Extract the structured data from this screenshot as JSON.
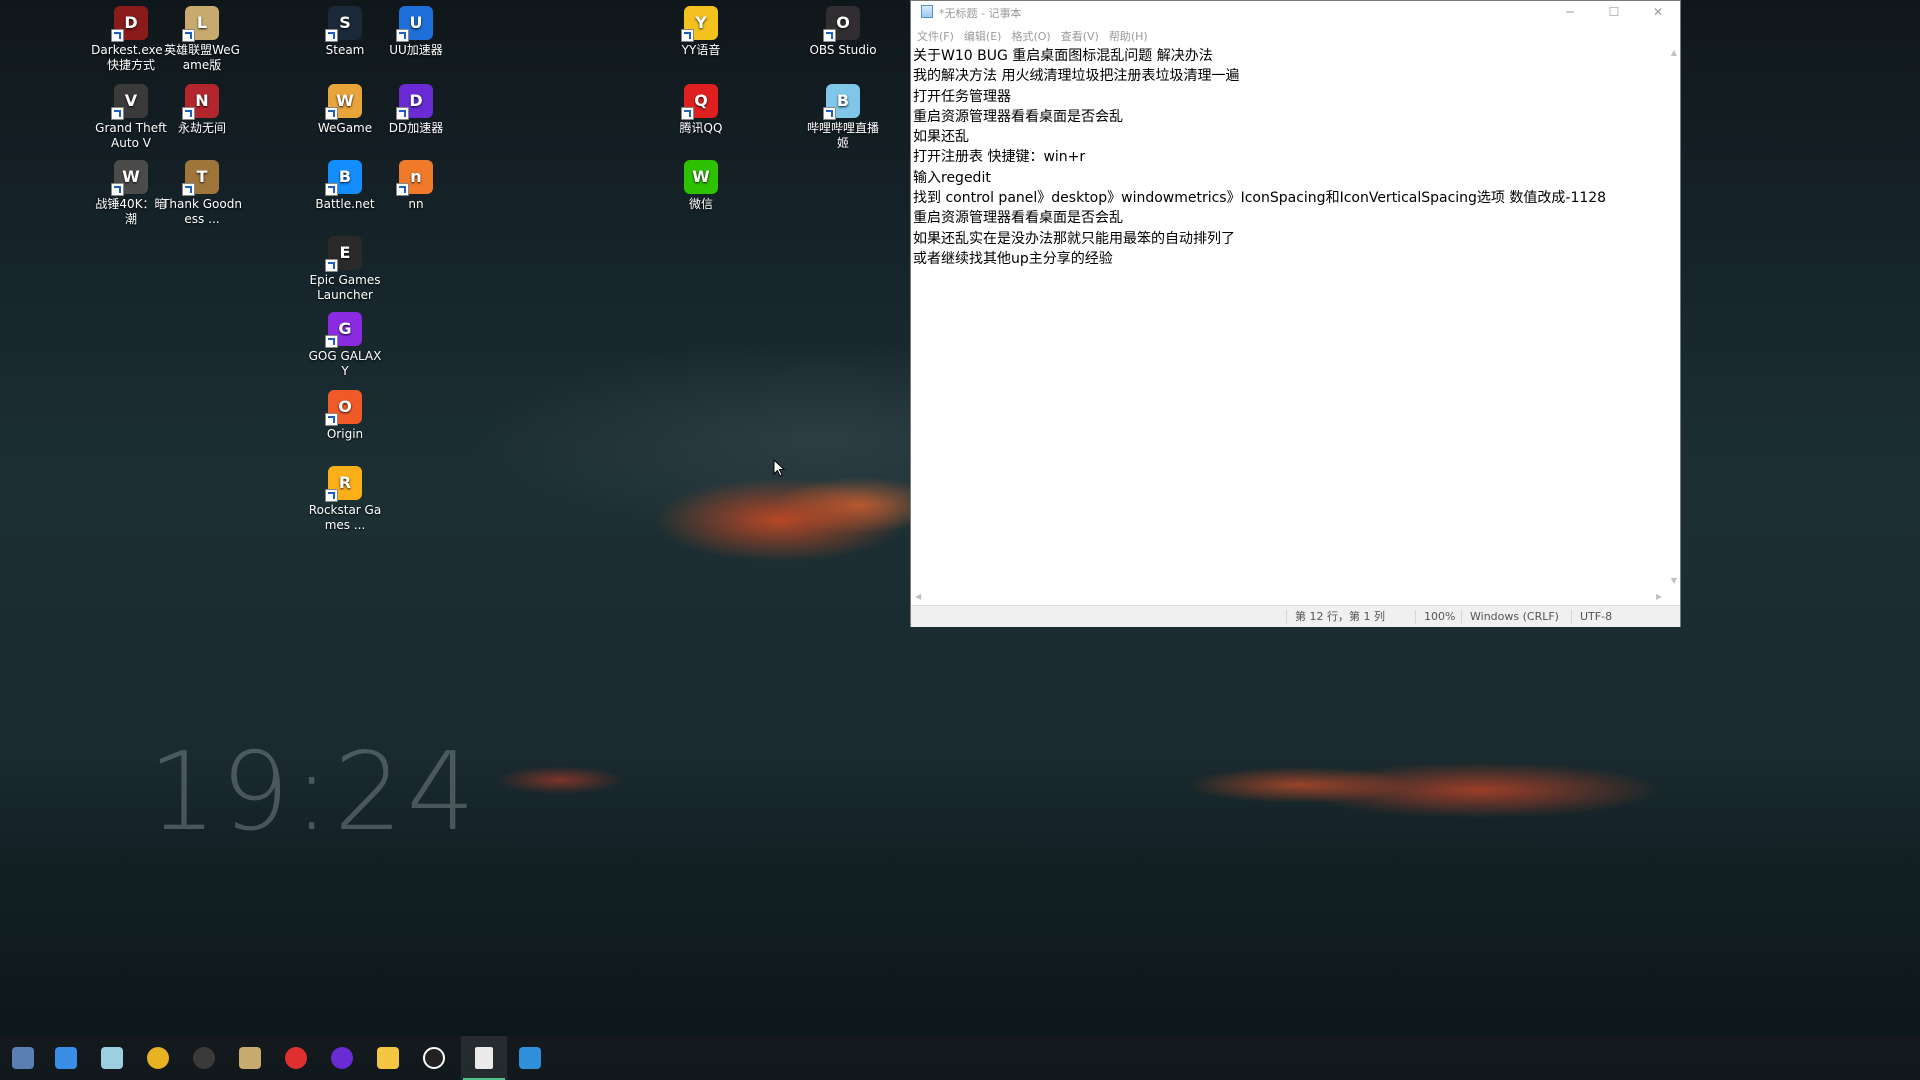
{
  "desktop": {
    "clock": "19:24",
    "icons": [
      {
        "label": "Darkest.exe - 快捷方式",
        "icon": "darkest-dungeon-icon",
        "color": "#8b1a1a"
      },
      {
        "label": "英雄联盟WeGame版",
        "icon": "league-of-legends-icon",
        "color": "#c8aa6e"
      },
      {
        "label": "Grand Theft Auto V",
        "icon": "gta-v-icon",
        "color": "#3a3a3a"
      },
      {
        "label": "永劫无间",
        "icon": "naraka-icon",
        "color": "#b3262e"
      },
      {
        "label": "战锤40K：暗潮",
        "icon": "darktide-icon",
        "color": "#4b4b4b"
      },
      {
        "label": "Thank Goodness ...",
        "icon": "thank-goodness-icon",
        "color": "#a0753a"
      },
      {
        "label": "Steam",
        "icon": "steam-icon",
        "color": "#1b2838"
      },
      {
        "label": "UU加速器",
        "icon": "uu-accelerator-icon",
        "color": "#1f6fd8"
      },
      {
        "label": "WeGame",
        "icon": "wegame-icon",
        "color": "#e8a33a"
      },
      {
        "label": "DD加速器",
        "icon": "dd-accelerator-icon",
        "color": "#6a2bd4"
      },
      {
        "label": "Battle.net",
        "icon": "battlenet-icon",
        "color": "#148eff"
      },
      {
        "label": "nn",
        "icon": "nn-accelerator-icon",
        "color": "#f07a2a"
      },
      {
        "label": "Epic Games Launcher",
        "icon": "epic-games-icon",
        "color": "#2a2a2a"
      },
      {
        "label": "GOG GALAXY",
        "icon": "gog-galaxy-icon",
        "color": "#8a2be2"
      },
      {
        "label": "Origin",
        "icon": "origin-icon",
        "color": "#f05a28"
      },
      {
        "label": "Rockstar Games ...",
        "icon": "rockstar-icon",
        "color": "#fcaf17"
      },
      {
        "label": "YY语音",
        "icon": "yy-voice-icon",
        "color": "#f4c21e"
      },
      {
        "label": "OBS Studio",
        "icon": "obs-studio-icon",
        "color": "#302e31"
      },
      {
        "label": "腾讯QQ",
        "icon": "qq-icon",
        "color": "#e02020"
      },
      {
        "label": "哔哩哔哩直播姬",
        "icon": "bilibili-live-icon",
        "color": "#7fc6e8"
      },
      {
        "label": "微信",
        "icon": "wechat-icon",
        "color": "#2dc100"
      }
    ]
  },
  "notepad": {
    "title": "*无标题 - 记事本",
    "window_buttons": {
      "minimize": "─",
      "maximize": "☐",
      "close": "✕"
    },
    "menu": [
      "文件(F)",
      "编辑(E)",
      "格式(O)",
      "查看(V)",
      "帮助(H)"
    ],
    "lines": [
      "关于W10  BUG 重启桌面图标混乱问题   解决办法",
      "我的解决方法 用火绒清理垃圾把注册表垃圾清理一遍",
      "打开任务管理器",
      "重启资源管理器看看桌面是否会乱",
      "如果还乱",
      "打开注册表  快捷键：win+r",
      "输入regedit",
      "找到 control panel》desktop》windowmetrics》IconSpacing和IconVerticalSpacing选项 数值改成-1128",
      "重启资源管理器看看桌面是否会乱",
      "如果还乱实在是没办法那就只能用最笨的自动排列了",
      "或者继续找其他up主分享的经验"
    ],
    "status": {
      "position": "第 12 行，第 1 列",
      "zoom": "100%",
      "line_ending": "Windows (CRLF)",
      "encoding": "UTF-8"
    }
  },
  "taskbar": {
    "items": [
      {
        "icon": "desktop-manager-icon",
        "color": "#5a7fb0",
        "active": false
      },
      {
        "icon": "blue-app-icon",
        "color": "#3a8ee6",
        "active": false
      },
      {
        "icon": "light-blue-app-icon",
        "color": "#9ecfe0",
        "active": false
      },
      {
        "icon": "chrome-icon",
        "color": "#e8b323",
        "active": false
      },
      {
        "icon": "obs-icon",
        "color": "#3a3a3a",
        "active": false
      },
      {
        "icon": "league-client-icon",
        "color": "#c8aa6e",
        "active": false
      },
      {
        "icon": "netease-music-icon",
        "color": "#e02f2f",
        "active": false
      },
      {
        "icon": "dd-accelerator-icon",
        "color": "#6a2bd4",
        "active": false
      },
      {
        "icon": "file-explorer-icon",
        "color": "#f4c542",
        "active": false
      },
      {
        "icon": "logitech-ghub-icon",
        "color": "#222222",
        "active": false
      },
      {
        "icon": "notepad-icon",
        "color": "#eaeaea",
        "active": true
      },
      {
        "icon": "blue-tool-icon",
        "color": "#2f8fd8",
        "active": false
      }
    ]
  }
}
